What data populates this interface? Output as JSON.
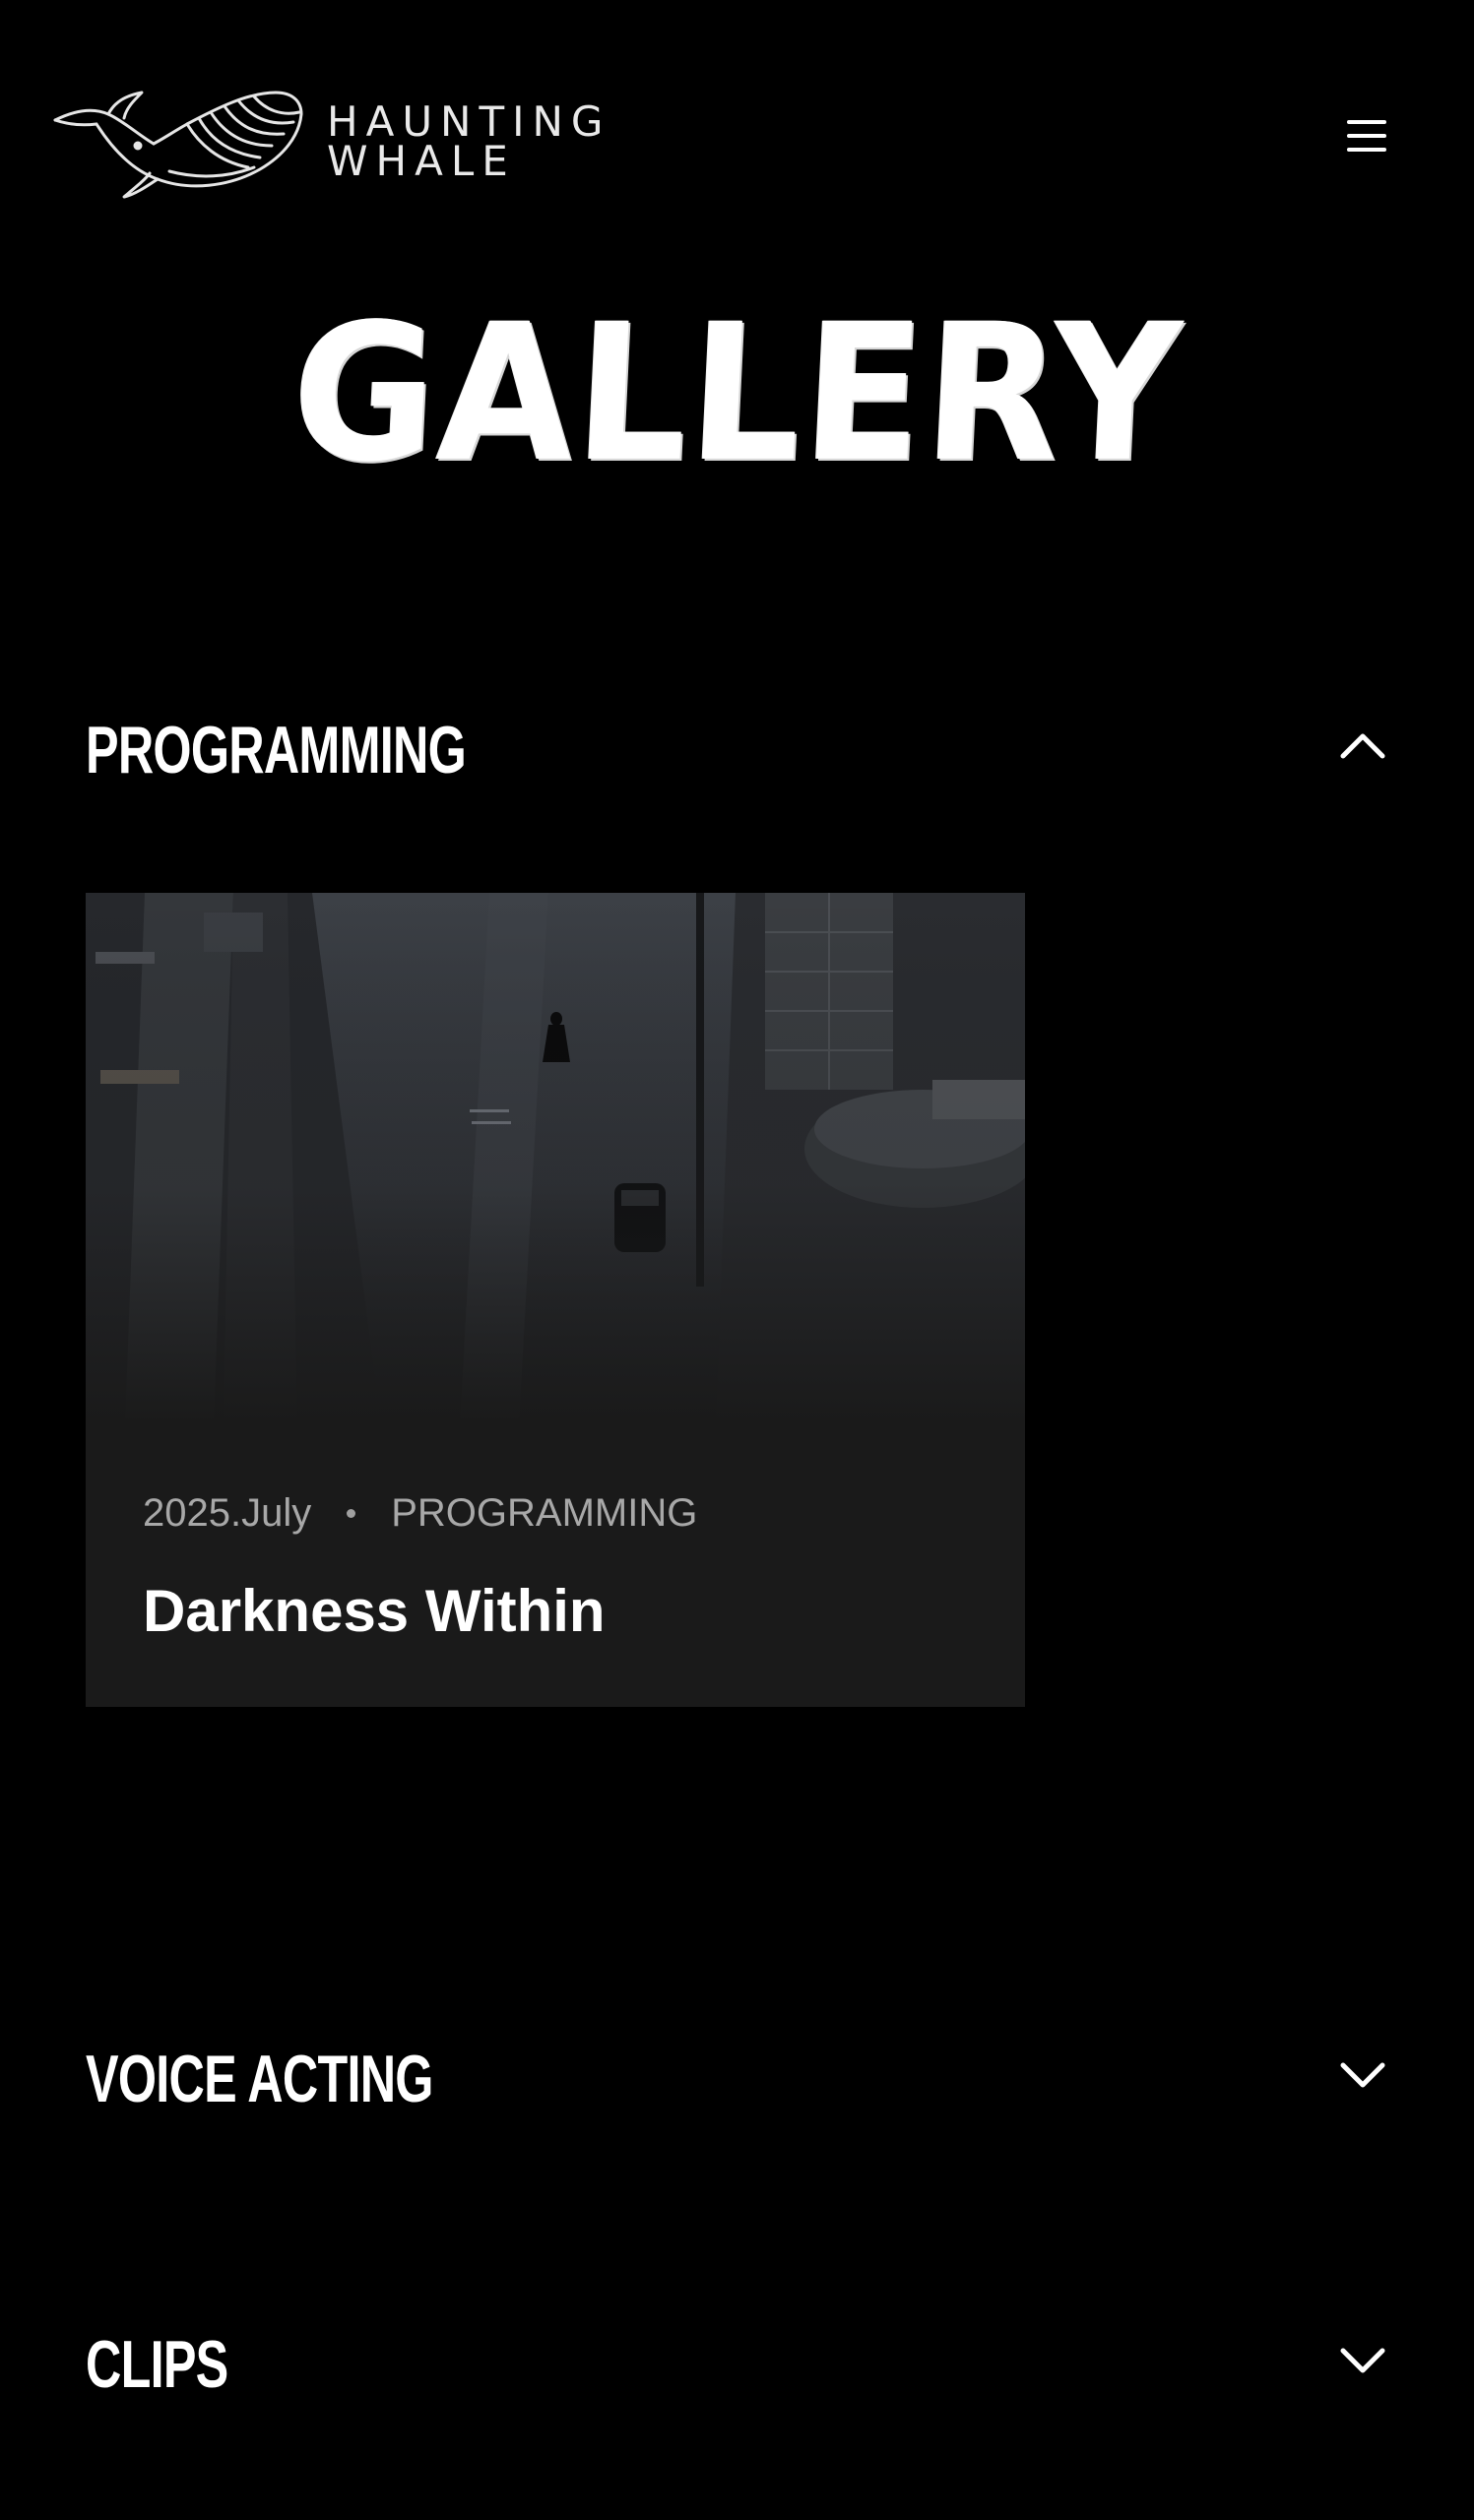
{
  "header": {
    "brand_line1": "HAUNTING",
    "brand_line2": "WHALE",
    "logo_icon": "whale-icon",
    "menu_icon": "hamburger-menu-icon"
  },
  "page": {
    "title": "GALLERY"
  },
  "sections": [
    {
      "title": "PROGRAMMING",
      "expanded": true,
      "chevron_icon": "chevron-up-icon",
      "cards": [
        {
          "date": "2025.July",
          "category": "PROGRAMMING",
          "title": "Darkness Within"
        }
      ]
    },
    {
      "title": "VOICE ACTING",
      "expanded": false,
      "chevron_icon": "chevron-down-icon"
    },
    {
      "title": "CLIPS",
      "expanded": false,
      "chevron_icon": "chevron-down-icon"
    }
  ],
  "colors": {
    "background": "#000000",
    "card_background": "#1a1a1a",
    "text_primary": "#ffffff",
    "text_secondary": "#a8a8a8"
  }
}
